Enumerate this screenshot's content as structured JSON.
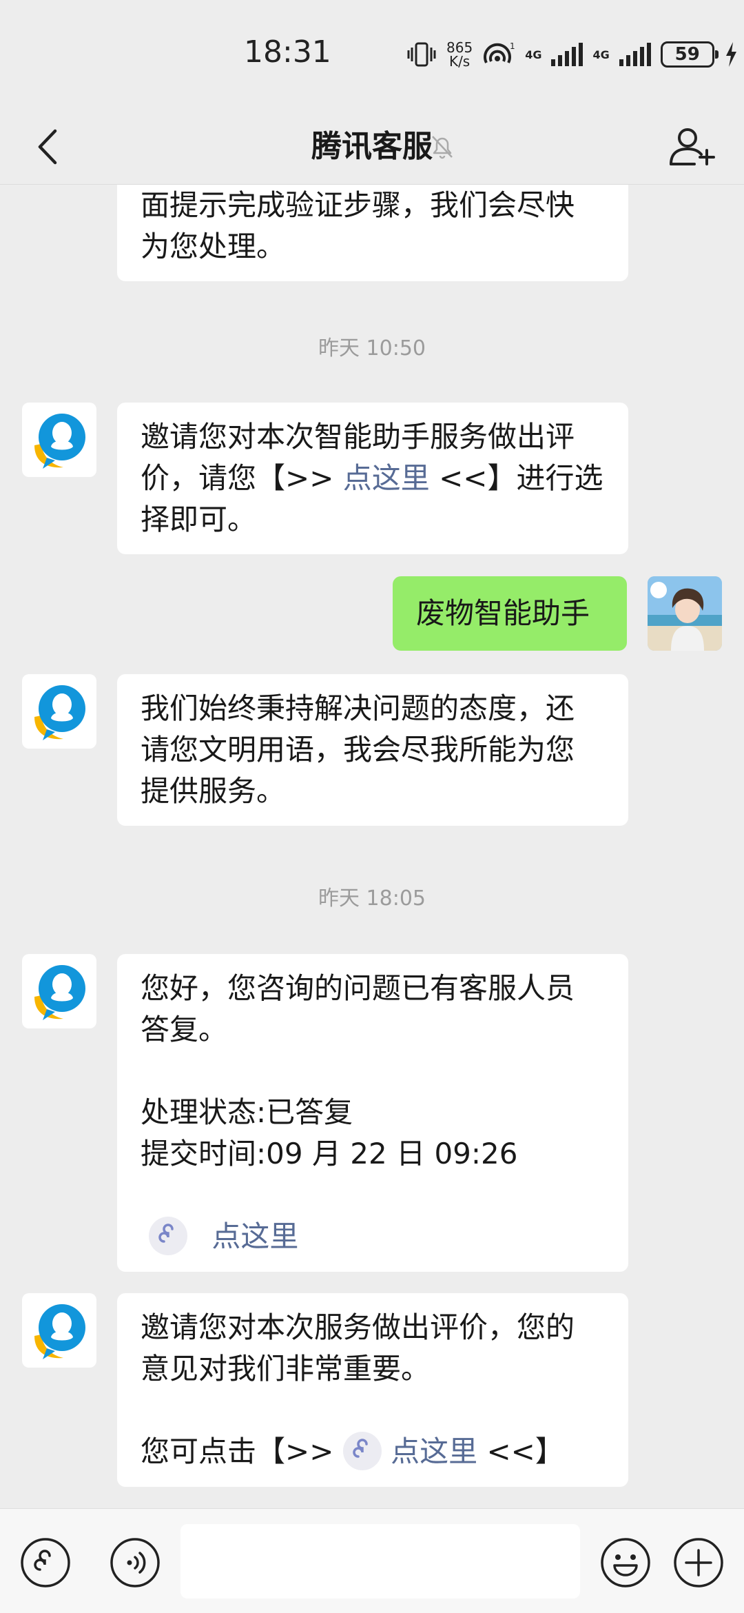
{
  "status_bar": {
    "time": "18:31",
    "speed_value": "865",
    "speed_unit": "K/s",
    "signal1_label": "4G",
    "signal2_label": "4G",
    "hotspot_sup": "1",
    "battery": "59"
  },
  "header": {
    "title": "腾讯客服",
    "icons": [
      "back-icon",
      "mute-bell-icon",
      "add-user-icon"
    ]
  },
  "messages": {
    "m0": {
      "line1": "面提示完成验证步骤，我们会尽快",
      "line2": "为您处理。"
    },
    "ts1": "昨天 10:50",
    "m1": {
      "line1": "邀请您对本次智能助手服务做出评",
      "line2_pre": "价，请您【>> ",
      "line2_link": "点这里",
      "line2_post": " <<】进行选",
      "line3": "择即可。"
    },
    "m2": {
      "text": "废物智能助手"
    },
    "m3": {
      "line1": "我们始终秉持解决问题的态度，还",
      "line2": "请您文明用语，我会尽我所能为您",
      "line3": "提供服务。"
    },
    "ts2": "昨天 18:05",
    "m4": {
      "line1": "您好，您咨询的问题已有客服人员",
      "line2": "答复。",
      "line3": "处理状态:已答复",
      "line4": "提交时间:09 月 22 日 09:26",
      "link": "点这里"
    },
    "m5": {
      "line1": "邀请您对本次服务做出评价，您的",
      "line2": "意见对我们非常重要。",
      "line3_pre": "您可点击【>> ",
      "line3_link": "点这里",
      "line3_post": " <<】"
    }
  },
  "bottom_bar": {
    "input_value": "",
    "icons": [
      "mini-program-icon",
      "voice-icon",
      "emoji-icon",
      "plus-icon"
    ]
  },
  "colors": {
    "background": "#ededed",
    "bubble_white": "#ffffff",
    "bubble_green": "#95ec69",
    "link": "#576b95",
    "qq_blue": "#1296db",
    "qq_yellow": "#f7b500"
  }
}
